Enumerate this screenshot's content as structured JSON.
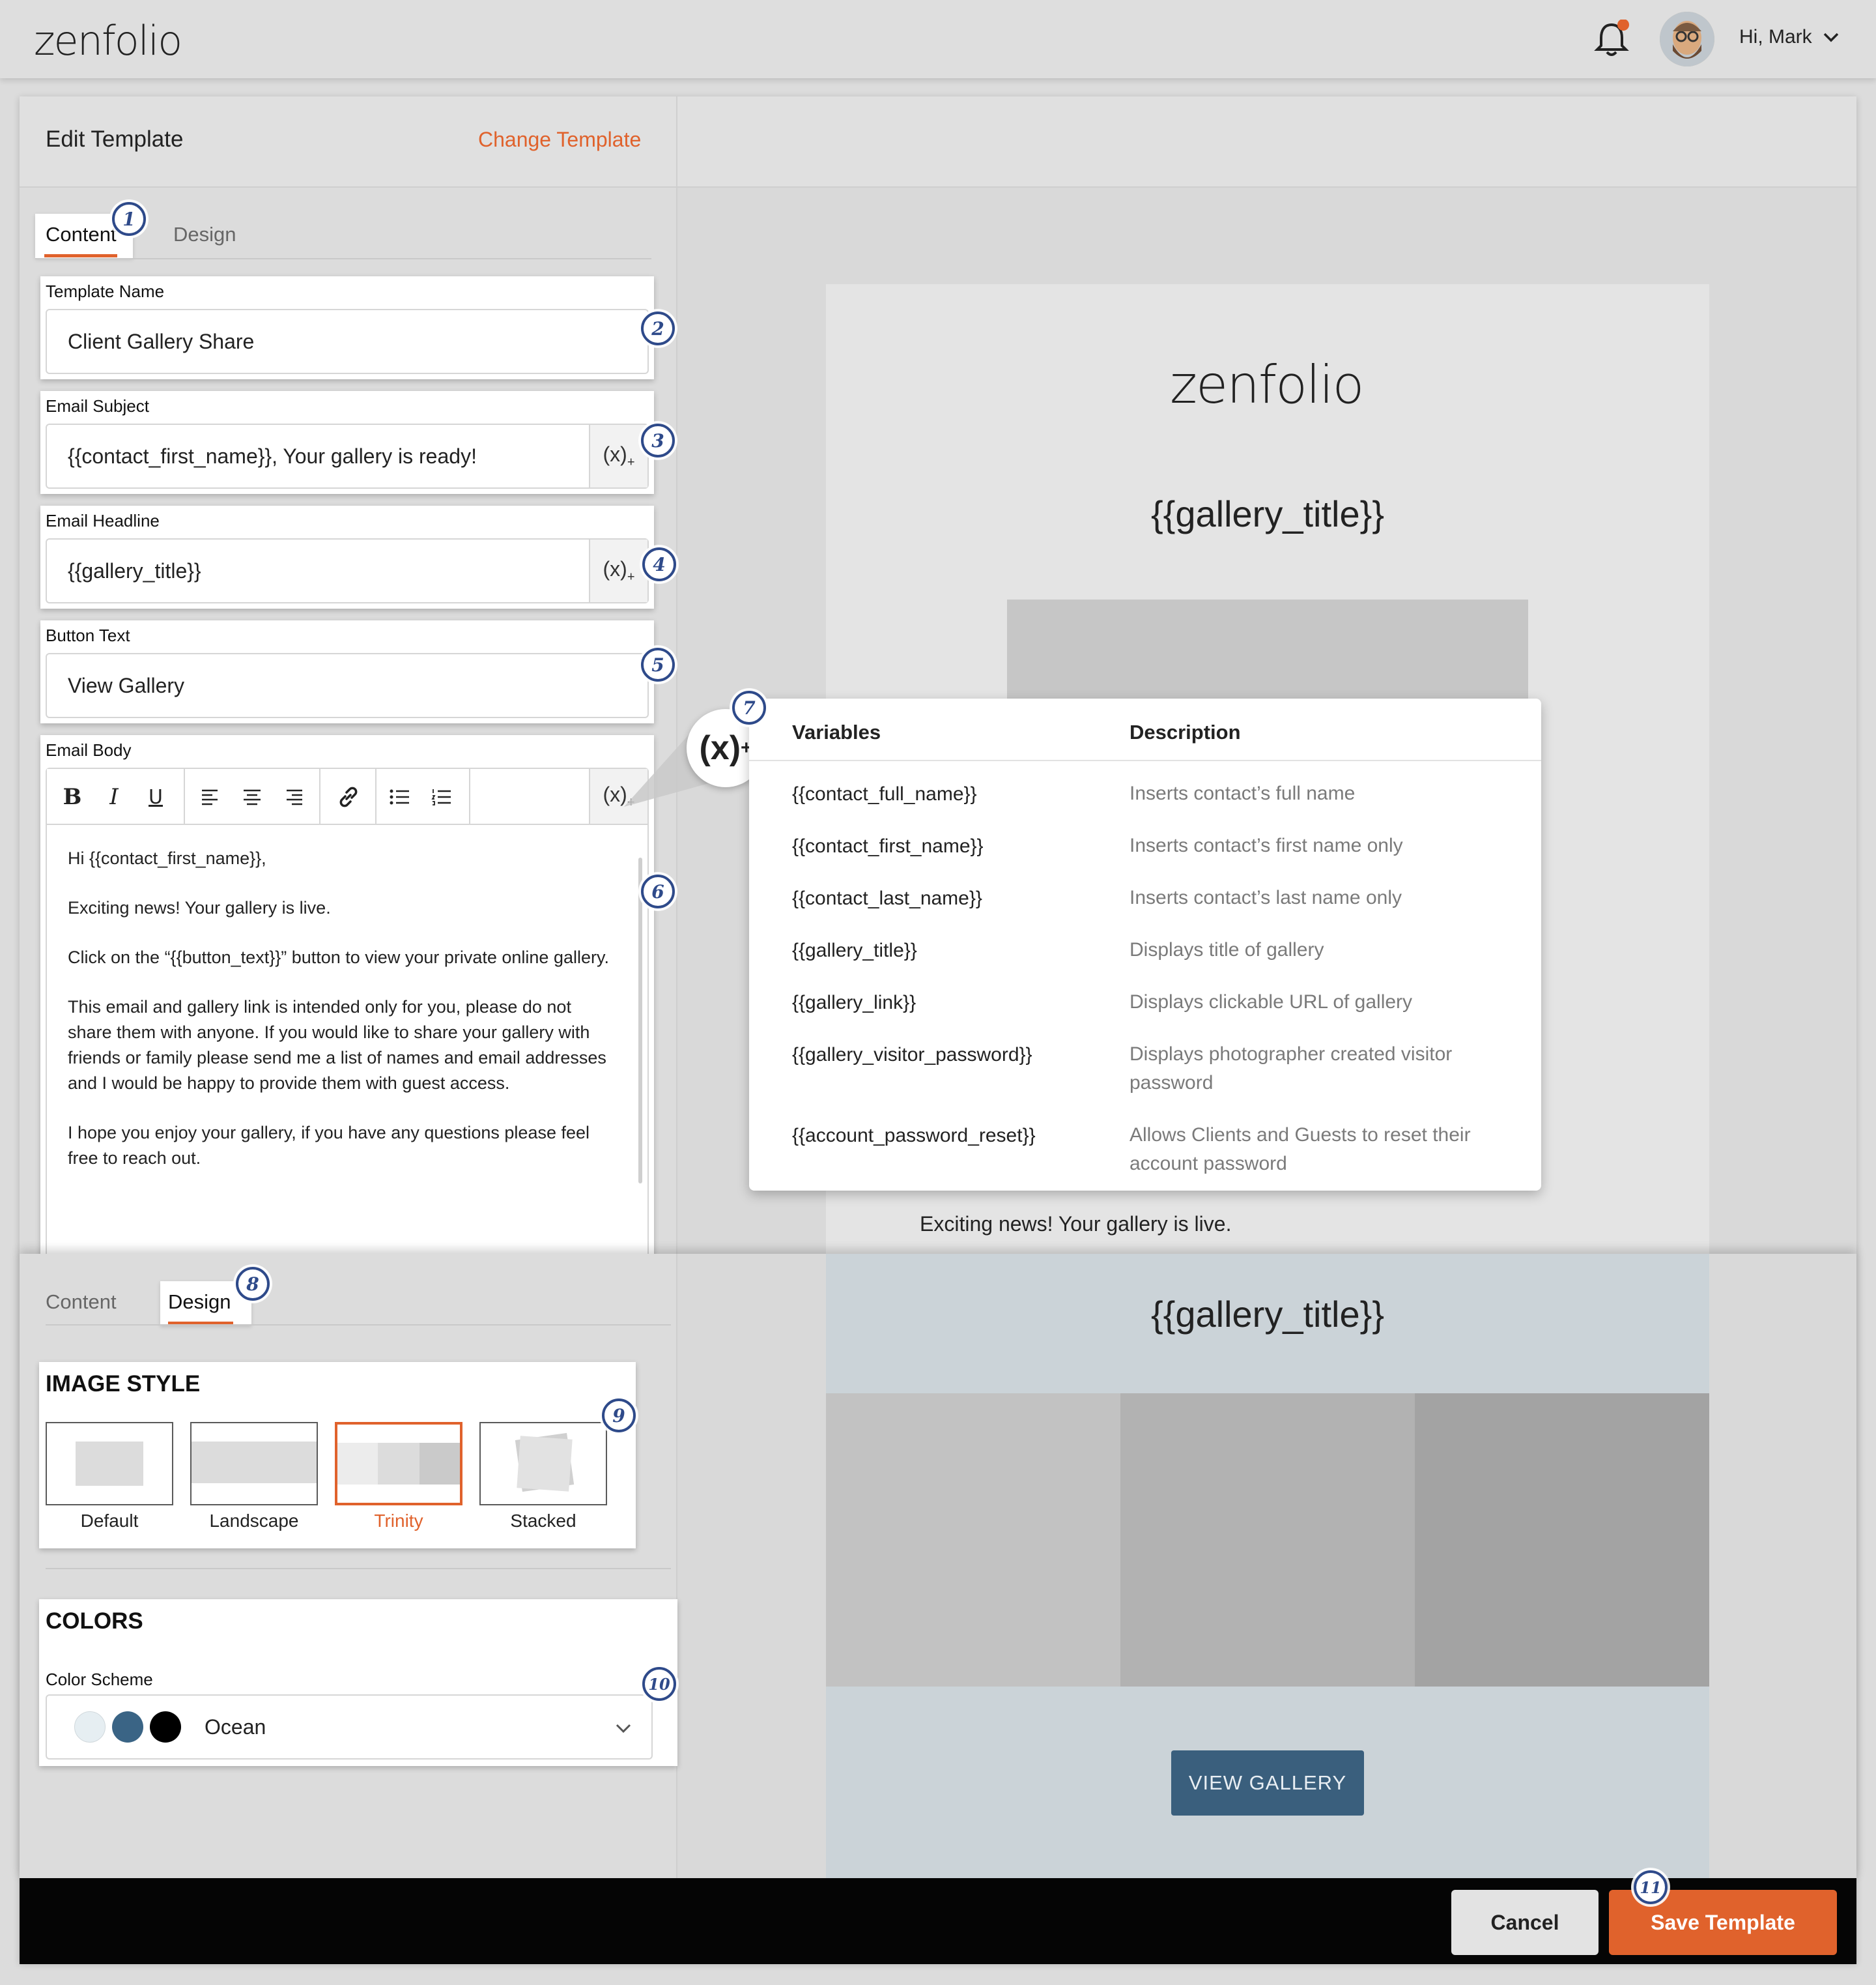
{
  "header": {
    "logo": "zenfolio",
    "user_greeting": "Hi, Mark"
  },
  "editor": {
    "title": "Edit Template",
    "change_template": "Change Template",
    "tabs": [
      "Content",
      "Design"
    ],
    "fields": {
      "template_name": {
        "label": "Template Name",
        "value": "Client Gallery Share"
      },
      "email_subject": {
        "label": "Email Subject",
        "value": "{{contact_first_name}}, Your gallery is ready!"
      },
      "email_headline": {
        "label": "Email Headline",
        "value": "{{gallery_title}}"
      },
      "button_text": {
        "label": "Button Text",
        "value": "View Gallery"
      },
      "email_body": {
        "label": "Email Body",
        "toolbar": {
          "bold": "B",
          "italic": "I",
          "underline": "U"
        },
        "paragraphs": [
          "Hi {{contact_first_name}},",
          "Exciting news! Your gallery is live.",
          "Click on the “{{button_text}}” button to view your private online gallery.",
          "This email and gallery link is intended only for you, please do not share them with anyone. If you would like to share your gallery with friends or family please send me a list of names and email addresses and I would be happy to provide them with guest access.",
          "I hope you enjoy your gallery, if you have any questions please feel free to reach out."
        ]
      }
    }
  },
  "variables_popup": {
    "col_variables": "Variables",
    "col_description": "Description",
    "rows": [
      {
        "name": "{{contact_full_name}}",
        "desc": "Inserts contact’s full name"
      },
      {
        "name": "{{contact_first_name}}",
        "desc": "Inserts contact’s first name only"
      },
      {
        "name": "{{contact_last_name}}",
        "desc": "Inserts contact’s last name only"
      },
      {
        "name": "{{gallery_title}}",
        "desc": "Displays title of gallery"
      },
      {
        "name": "{{gallery_link}}",
        "desc": "Displays clickable URL of gallery"
      },
      {
        "name": "{{gallery_visitor_password}}",
        "desc": "Displays photographer created visitor password"
      },
      {
        "name": "{{account_password_reset}}",
        "desc": "Allows Clients and Guests to reset their account password"
      }
    ]
  },
  "preview": {
    "logo": "zenfolio",
    "headline": "{{gallery_title}}",
    "body_line": "Exciting news! Your gallery is live.",
    "headline_2": "{{gallery_title}}",
    "button": "VIEW GALLERY"
  },
  "design": {
    "tabs": [
      "Content",
      "Design"
    ],
    "image_style": {
      "title": "IMAGE STYLE",
      "options": [
        "Default",
        "Landscape",
        "Trinity",
        "Stacked"
      ],
      "selected": "Trinity"
    },
    "colors": {
      "title": "COLORS",
      "label": "Color Scheme",
      "value": "Ocean",
      "swatches": [
        "#e6eef2",
        "#3a6485",
        "#000000"
      ]
    }
  },
  "footer": {
    "cancel": "Cancel",
    "save": "Save Template"
  },
  "callouts": [
    "1",
    "2",
    "3",
    "4",
    "5",
    "6",
    "7",
    "8",
    "9",
    "10",
    "11"
  ],
  "colors": {
    "accent": "#e0622c",
    "button_blue": "#3a5f7d"
  }
}
